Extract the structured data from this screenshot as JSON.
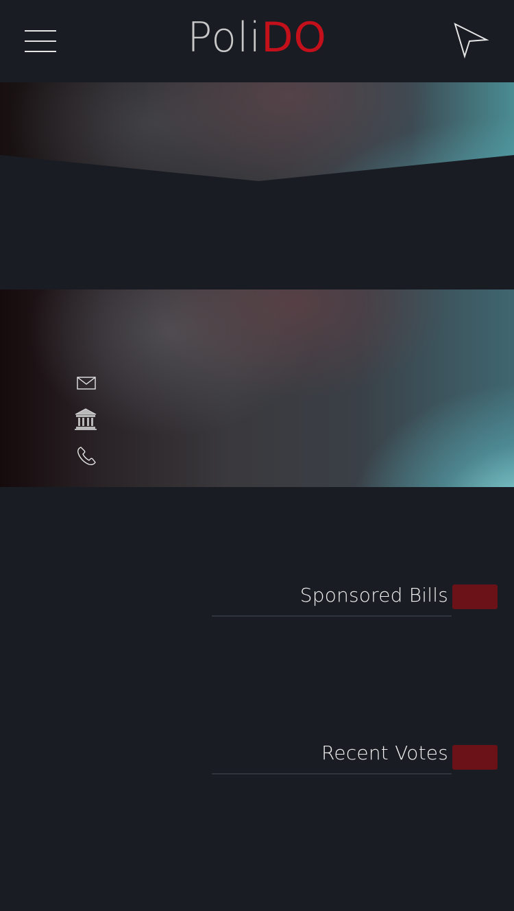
{
  "app": {
    "logo_part1": "Poli",
    "logo_part2": "DO",
    "brand_colors": {
      "background": "#191d23",
      "accent_red": "#c4101a",
      "badge_red": "#6b1219"
    }
  },
  "header": {
    "menu_icon": "hamburger-menu-icon",
    "location_icon": "navigation-arrow-icon"
  },
  "contact": {
    "icons": [
      "envelope-icon",
      "capitol-building-icon",
      "phone-icon"
    ]
  },
  "sections": [
    {
      "title": "Sponsored Bills"
    },
    {
      "title": "Recent Votes"
    }
  ]
}
